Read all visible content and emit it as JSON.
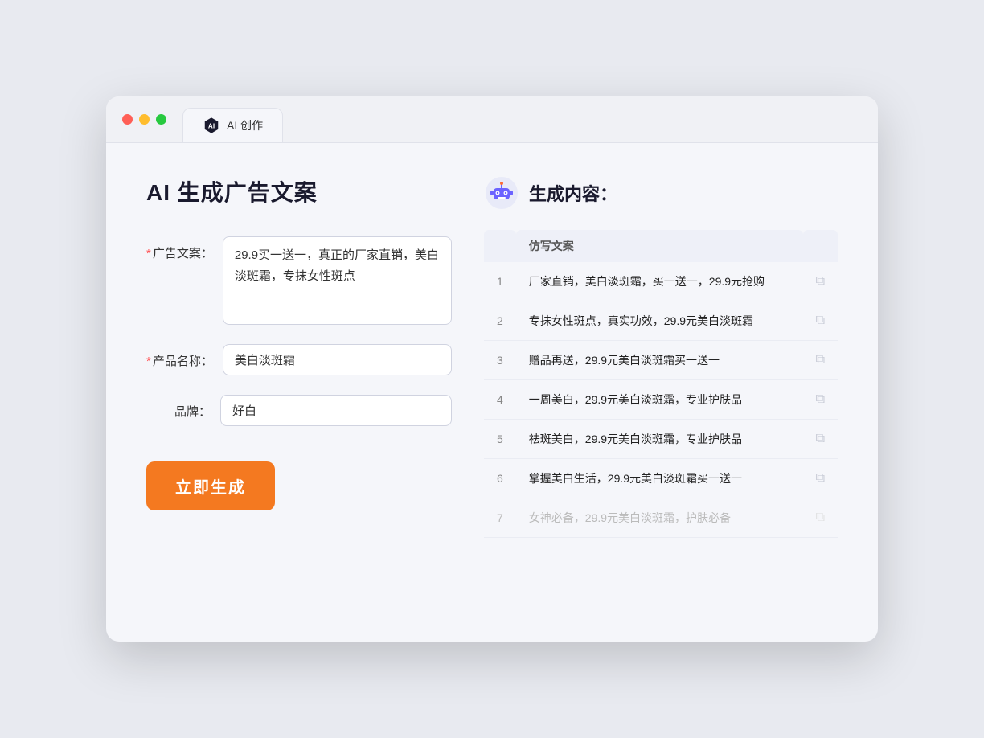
{
  "browser": {
    "tab_label": "AI 创作"
  },
  "page": {
    "title": "AI 生成广告文案",
    "form": {
      "ad_copy_label": "广告文案：",
      "ad_copy_required": "*",
      "ad_copy_value": "29.9买一送一，真正的厂家直销，美白淡斑霜，专抹女性斑点",
      "product_name_label": "产品名称：",
      "product_name_required": "*",
      "product_name_value": "美白淡斑霜",
      "brand_label": "品牌：",
      "brand_value": "好白",
      "generate_btn": "立即生成"
    },
    "result": {
      "title": "生成内容：",
      "table_header": "仿写文案",
      "items": [
        {
          "id": 1,
          "text": "厂家直销，美白淡斑霜，买一送一，29.9元抢购"
        },
        {
          "id": 2,
          "text": "专抹女性斑点，真实功效，29.9元美白淡斑霜"
        },
        {
          "id": 3,
          "text": "赠品再送，29.9元美白淡斑霜买一送一"
        },
        {
          "id": 4,
          "text": "一周美白，29.9元美白淡斑霜，专业护肤品"
        },
        {
          "id": 5,
          "text": "祛斑美白，29.9元美白淡斑霜，专业护肤品"
        },
        {
          "id": 6,
          "text": "掌握美白生活，29.9元美白淡斑霜买一送一"
        },
        {
          "id": 7,
          "text": "女神必备，29.9元美白淡斑霜，护肤必备",
          "muted": true
        }
      ]
    }
  },
  "colors": {
    "orange": "#f47920",
    "accent_blue": "#4e6ef2"
  }
}
